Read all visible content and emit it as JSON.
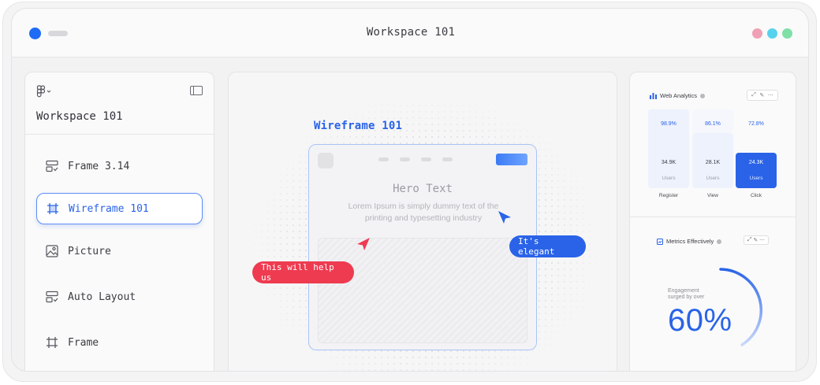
{
  "window": {
    "title": "Workspace 101",
    "lights": [
      "#f0a0b4",
      "#57d2ec",
      "#7fe0a8"
    ],
    "accent": "#1e6cf5"
  },
  "sidebar": {
    "title": "Workspace 101",
    "items": [
      {
        "label": "Frame 3.14",
        "icon": "frame-check-icon"
      },
      {
        "label": "Wireframe 101",
        "icon": "frame-grid-icon",
        "active": true
      },
      {
        "label": "Picture",
        "icon": "image-icon"
      },
      {
        "label": "Auto Layout",
        "icon": "auto-layout-icon"
      },
      {
        "label": "Frame",
        "icon": "frame-icon"
      }
    ]
  },
  "canvas": {
    "frame_label": "Wireframe 101",
    "hero_title": "Hero Text",
    "hero_text": "Lorem Ipsum is simply dummy text of the printing and typesetting industry",
    "comment_red": "This will help us",
    "comment_blue": "It's elegant",
    "red_color": "#ee3b50",
    "blue_color": "#2a63e8"
  },
  "analytics": {
    "title": "Web Analytics",
    "columns": [
      {
        "label": "Register",
        "percent": "98.9%",
        "value": "34.9K",
        "unit": "Users"
      },
      {
        "label": "View",
        "percent": "86.1%",
        "value": "28.1K",
        "unit": "Users"
      },
      {
        "label": "Click",
        "percent": "72.8%",
        "value": "24.3K",
        "unit": "Users"
      }
    ]
  },
  "metrics": {
    "title": "Metrics Effectively",
    "caption": "Engagement surged by over",
    "value": "60%",
    "progress": 0.6
  }
}
